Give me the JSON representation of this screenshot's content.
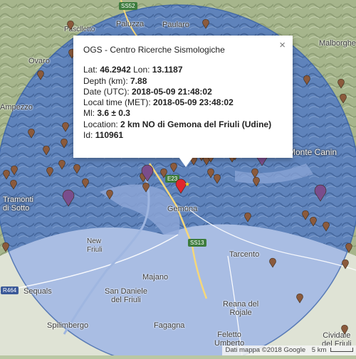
{
  "map": {
    "center_region": "Friuli",
    "colors": {
      "terrain": "#a9b88f",
      "terrain_dark": "#7d8f68",
      "circle_fill": "#3a6fc4",
      "marker_small": "#8b5a3c",
      "marker_large": "#7a4d8c",
      "epicenter": "#e0262e"
    }
  },
  "places": {
    "palluzza": "Paluzza",
    "paularo": "Paularo",
    "ovaro": "Ovaro",
    "ampezzo": "Ampezzo",
    "tramonti": "Tramonti\ndi Sotto",
    "gemona": "Gemona",
    "tarcento": "Tarcento",
    "majano": "Majano",
    "san_daniele": "San Daniele\ndel Friuli",
    "sequals": "Sequals",
    "spilimbergo": "Spilimbergo",
    "fagagna": "Fagagna",
    "reana": "Reana del\nRojale",
    "feletto": "Feletto\nUmberto",
    "cividale": "Cividale\ndel Friuli",
    "malborghetto": "Malborghe",
    "monte_canin": "Monte Canin",
    "forni": "New\nFriuli",
    "pasclletto": "Pasclletto"
  },
  "roads": {
    "ss52": "SS52",
    "e23": "E23",
    "ss13": "SS13",
    "r464": "R464"
  },
  "popup": {
    "title": "OGS - Centro Ricerche Sismologiche",
    "close_symbol": "×",
    "lat_label": "Lat:",
    "lat_value": "46.2942",
    "lon_label": "Lon:",
    "lon_value": "13.1187",
    "depth_label": "Depth (km):",
    "depth_value": "7.88",
    "date_label": "Date (UTC):",
    "date_value": "2018-05-09 21:48:02",
    "local_label": "Local time (MET):",
    "local_value": "2018-05-09 23:48:02",
    "ml_label": "Ml:",
    "ml_value": "3.6 ± 0.3",
    "location_label": "Location:",
    "location_value": "2 km NO di Gemona del Friuli (Udine)",
    "id_label": "Id:",
    "id_value": "110961"
  },
  "attribution": {
    "text": "Dati mappa ©2018 Google",
    "scale": "5 km"
  }
}
